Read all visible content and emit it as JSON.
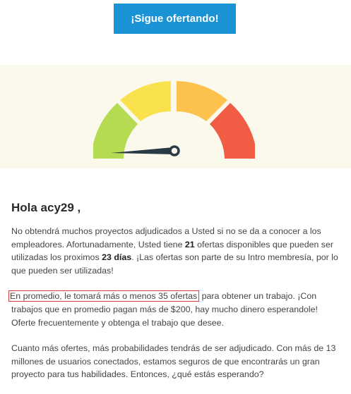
{
  "cta": {
    "label": "¡Sigue ofertando!"
  },
  "gauge": {
    "segments": [
      {
        "name": "green",
        "color": "#b5db52"
      },
      {
        "name": "yellow",
        "color": "#f9e24d"
      },
      {
        "name": "orange",
        "color": "#fdc24d"
      },
      {
        "name": "red",
        "color": "#f05c44"
      }
    ],
    "needle_color": "#2a3a44",
    "background": "#fbf9ec"
  },
  "greeting": "Hola acy29 ,",
  "paragraph1": {
    "part1": "No obtendrá muchos proyectos adjudicados a Usted si no se da a conocer a los empleadores. Afortunadamente, Usted tiene ",
    "bids_count": "21",
    "part2": " ofertas disponibles que pueden ser utilizadas los proximos ",
    "days": "23 días",
    "part3": ". ¡Las ofertas son parte de su Intro membresía, por lo que pueden ser utilizadas!"
  },
  "paragraph2": {
    "highlight": "En promedio, le tomará más o menos 35 ofertas",
    "rest": " para obtener un trabajo. ¡Con trabajos que en promedio pagan más de $200, hay mucho dinero esperandole! Oferte frecuentemente y obtenga el trabajo que desee."
  },
  "paragraph3": "Cuanto más ofertes, más probabilidades tendrás de ser adjudicado. Con más de 13 millones de usuarios conectados, estamos seguros de que encontrarás un gran proyecto para tus habilidades. Entonces, ¿qué estás esperando?"
}
